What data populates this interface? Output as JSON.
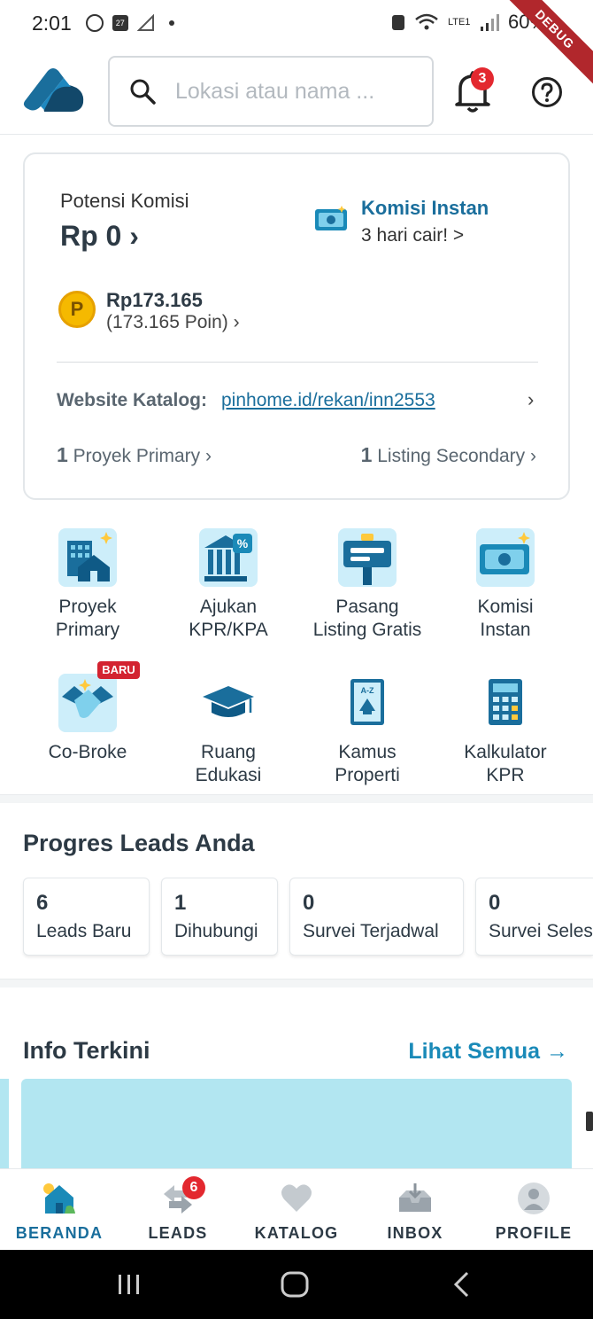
{
  "status_bar": {
    "time": "2:01",
    "battery": "60%",
    "network": "LTE1",
    "debug_label": "DEBUG"
  },
  "header": {
    "search_placeholder": "Lokasi atau nama ...",
    "notification_count": "3"
  },
  "commission_card": {
    "potensi_label": "Potensi Komisi",
    "potensi_value": "Rp 0 ›",
    "instant_title": "Komisi Instan",
    "instant_subtitle": "3 hari cair! >",
    "points_amount": "Rp173.165",
    "points_detail": "(173.165 Poin) ›",
    "website_label": "Website Katalog:",
    "website_link": "pinhome.id/rekan/inn2553",
    "website_chevron": "›",
    "primary_count": "1",
    "primary_label": "Proyek Primary ›",
    "secondary_count": "1",
    "secondary_label": "Listing Secondary ›"
  },
  "menu": {
    "items": [
      {
        "label": "Proyek\nPrimary",
        "line1": "Proyek",
        "line2": "Primary"
      },
      {
        "line1": "Ajukan",
        "line2": "KPR/KPA"
      },
      {
        "line1": "Pasang",
        "line2": "Listing Gratis"
      },
      {
        "line1": "Komisi",
        "line2": "Instan"
      },
      {
        "line1": "Co-Broke",
        "line2": ""
      },
      {
        "line1": "Ruang",
        "line2": "Edukasi"
      },
      {
        "line1": "Kamus",
        "line2": "Properti"
      },
      {
        "line1": "Kalkulator",
        "line2": "KPR"
      }
    ],
    "new_badge": "BARU"
  },
  "leads": {
    "title": "Progres Leads Anda",
    "cards": [
      {
        "count": "6",
        "label": "Leads Baru"
      },
      {
        "count": "1",
        "label": "Dihubungi"
      },
      {
        "count": "0",
        "label": "Survei Terjadwal"
      },
      {
        "count": "0",
        "label": "Survei Seles"
      }
    ]
  },
  "info": {
    "title": "Info Terkini",
    "see_all": "Lihat Semua →"
  },
  "bottom_nav": {
    "items": [
      {
        "label": "BERANDA"
      },
      {
        "label": "LEADS"
      },
      {
        "label": "KATALOG"
      },
      {
        "label": "INBOX"
      },
      {
        "label": "PROFILE"
      }
    ],
    "leads_badge": "6"
  },
  "colors": {
    "brand": "#1a6e9c",
    "accent": "#1a8ab8",
    "badge": "#e3282f",
    "banner": "#b2e6f1"
  }
}
